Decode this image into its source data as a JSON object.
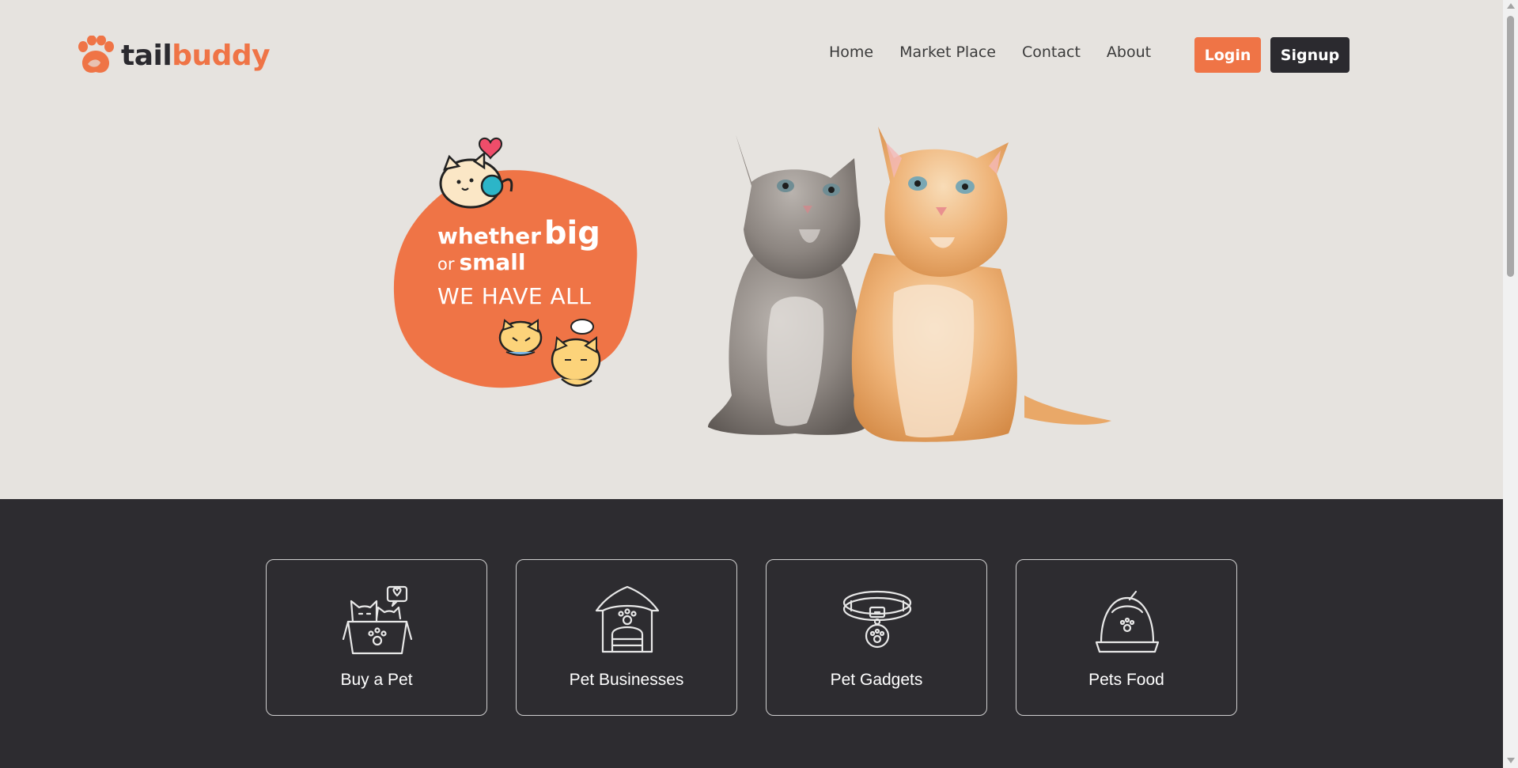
{
  "brand": {
    "part1": "tail",
    "part2": "buddy",
    "accent": "#ef7446",
    "dark": "#2b2a2f"
  },
  "nav": {
    "items": [
      {
        "label": "Home"
      },
      {
        "label": "Market Place"
      },
      {
        "label": "Contact"
      },
      {
        "label": "About"
      }
    ],
    "login_label": "Login",
    "signup_label": "Signup"
  },
  "hero": {
    "line1_word": "whether",
    "line1_big": "big",
    "line2_or": "or",
    "line2_small": "small",
    "line3": "WE HAVE ALL",
    "image": "two-kittens-photo",
    "bg": "#e6e3df"
  },
  "categories": [
    {
      "label": "Buy a Pet",
      "icon": "cats-in-box-icon"
    },
    {
      "label": "Pet Businesses",
      "icon": "pet-house-icon"
    },
    {
      "label": "Pet Gadgets",
      "icon": "pet-collar-icon"
    },
    {
      "label": "Pets Food",
      "icon": "pet-food-bowl-icon"
    }
  ]
}
